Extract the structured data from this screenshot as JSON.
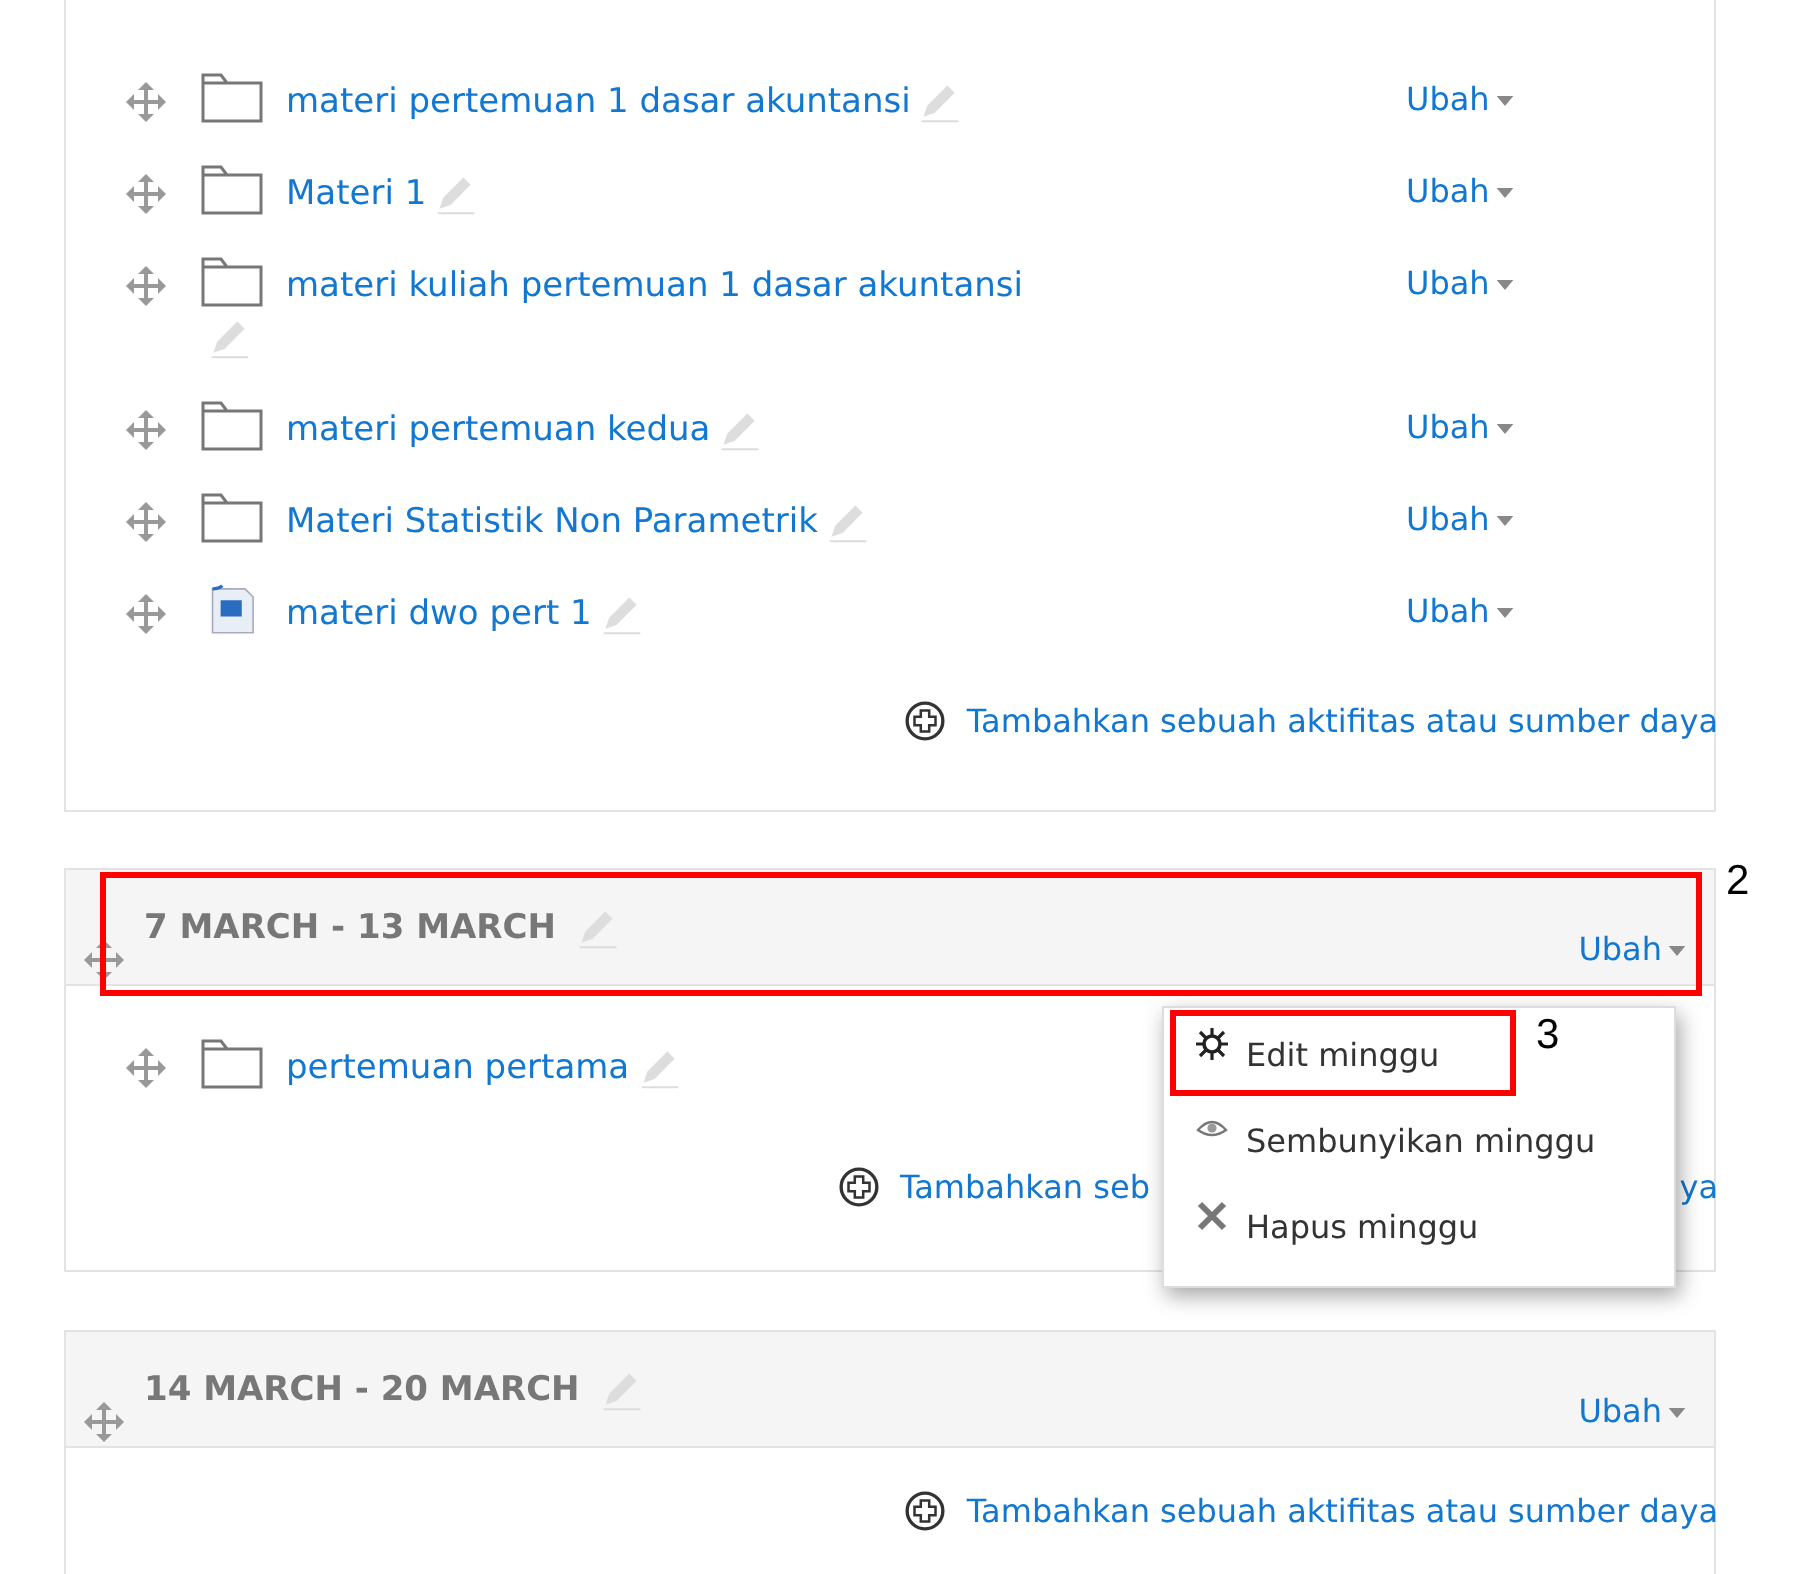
{
  "sections": [
    {
      "items": [
        {
          "kind": "folder",
          "name": "materi pertemuan 1 dasar akuntansi",
          "action": "Ubah"
        },
        {
          "kind": "folder",
          "name": "Materi 1",
          "action": "Ubah"
        },
        {
          "kind": "folder",
          "name": "materi kuliah pertemuan 1 dasar akuntansi",
          "action": "Ubah"
        },
        {
          "kind": "folder",
          "name": "materi pertemuan kedua",
          "action": "Ubah"
        },
        {
          "kind": "folder",
          "name": "Materi Statistik Non Parametrik",
          "action": "Ubah"
        },
        {
          "kind": "word",
          "name": "materi dwo pert 1",
          "action": "Ubah"
        }
      ],
      "add_link": "Tambahkan sebuah aktifitas atau sumber daya"
    },
    {
      "title": "7 MARCH - 13 MARCH",
      "action": "Ubah",
      "annotation": "2",
      "items": [
        {
          "kind": "folder",
          "name": "pertemuan pertama"
        }
      ],
      "add_link": "Tambahkan seb",
      "add_link_end": "ya",
      "menu": {
        "items": [
          {
            "kind": "edit",
            "label": "Edit minggu",
            "annotation": "3"
          },
          {
            "kind": "hide",
            "label": "Sembunyikan minggu"
          },
          {
            "kind": "delete",
            "label": "Hapus minggu"
          }
        ]
      }
    },
    {
      "title": "14 MARCH - 20 MARCH",
      "action": "Ubah",
      "add_link": "Tambahkan sebuah aktifitas atau sumber daya"
    }
  ]
}
